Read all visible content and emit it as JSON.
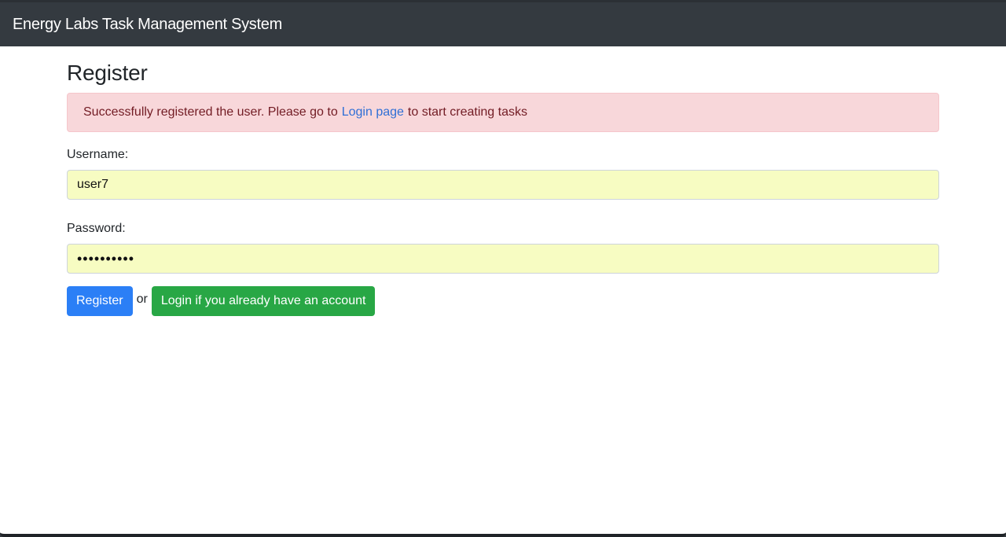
{
  "navbar": {
    "brand": "Energy Labs Task Management System"
  },
  "page": {
    "title": "Register"
  },
  "alert": {
    "text_before": "Successfully registered the user. Please go to",
    "link_text": "Login page",
    "text_after": "to start creating tasks"
  },
  "form": {
    "username_label": "Username:",
    "username_value": "user7",
    "password_label": "Password:",
    "password_value": "••••••••••"
  },
  "actions": {
    "register_label": "Register",
    "or_text": "or",
    "login_label": "Login if you already have an account"
  },
  "colors": {
    "navbar": "#343a40",
    "alert_bg": "#f8d7da",
    "primary": "#2b7ff6",
    "success": "#28a745",
    "autofill": "#f7fcc2"
  }
}
